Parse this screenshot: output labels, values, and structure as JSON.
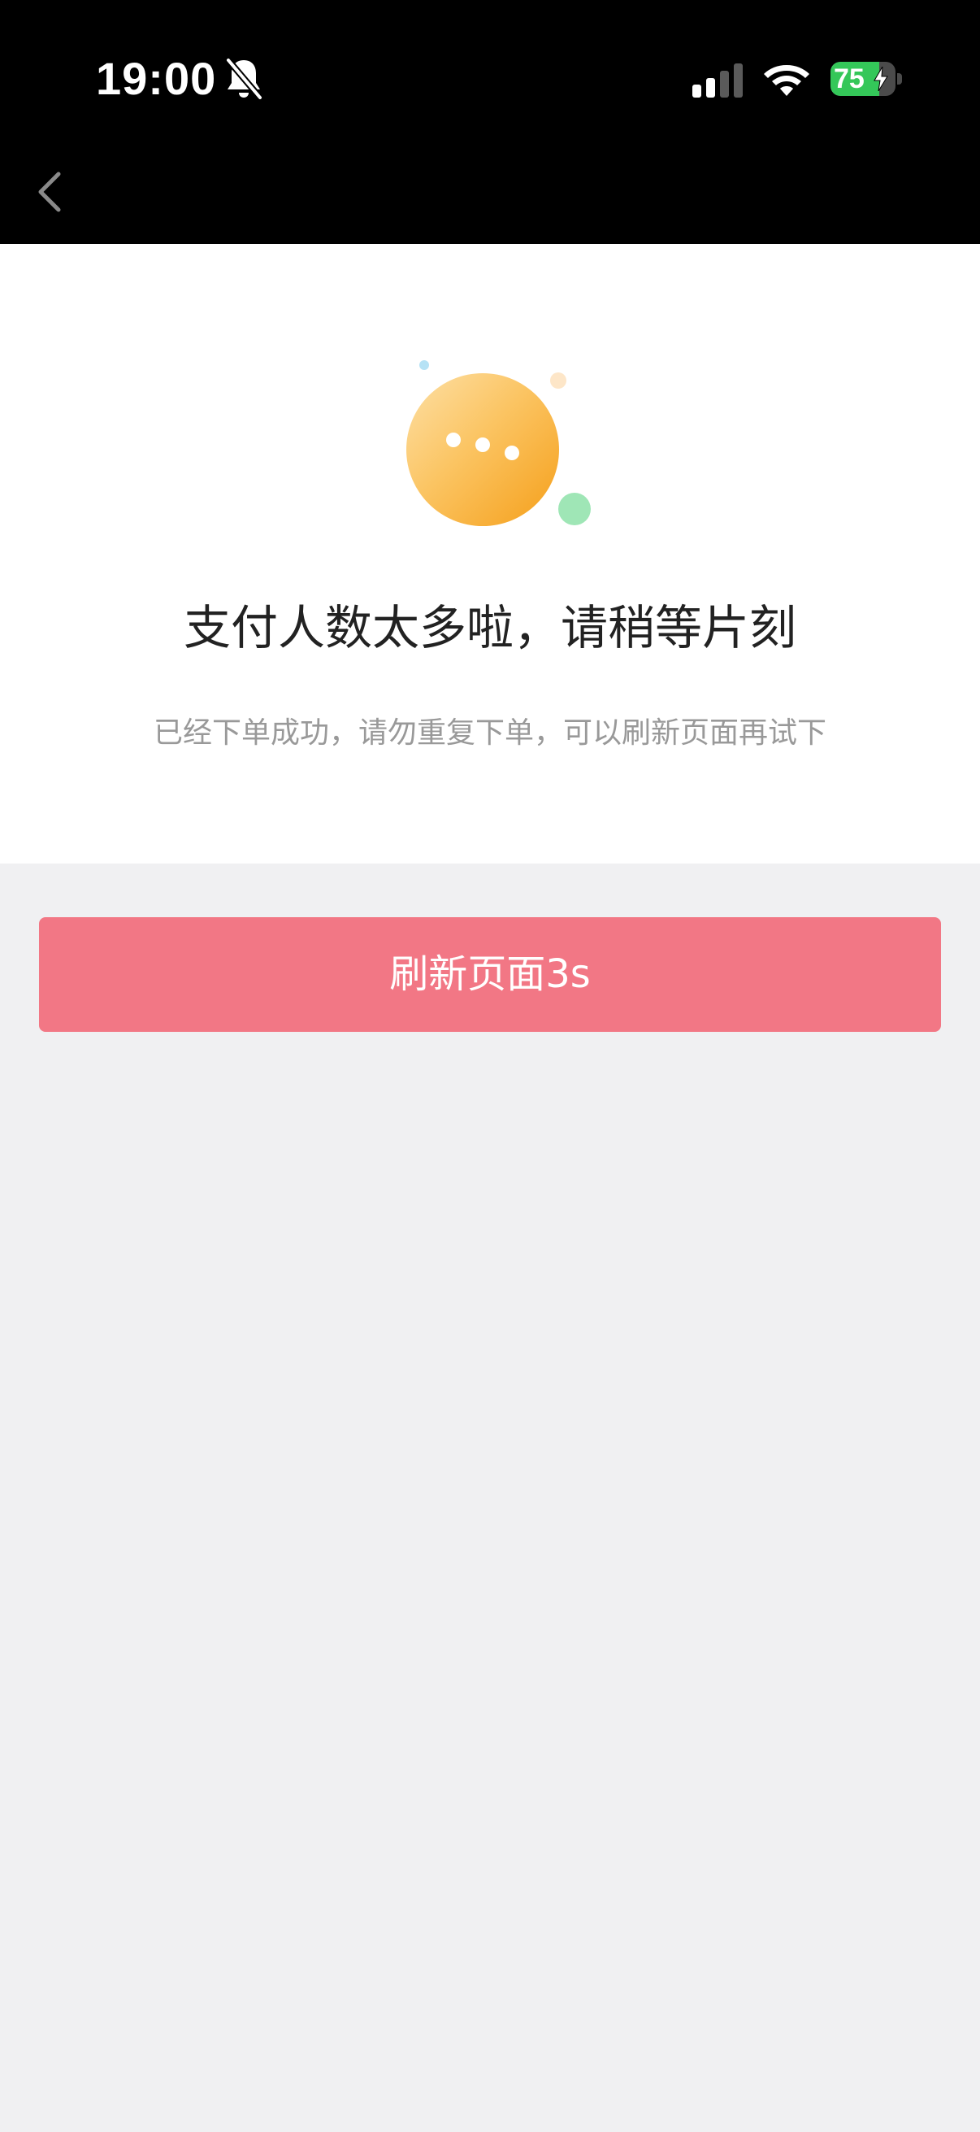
{
  "status_bar": {
    "time": "19:00",
    "battery_level": "75",
    "icons": [
      "bell-off-icon",
      "signal-icon",
      "wifi-icon",
      "battery-icon",
      "bolt-icon"
    ]
  },
  "nav": {
    "back_icon": "chevron-left-icon"
  },
  "main": {
    "illustration_icon": "chat-bubble-dots-icon",
    "headline": "支付人数太多啦，请稍等片刻",
    "subtext": "已经下单成功，请勿重复下单，可以刷新页面再试下"
  },
  "actions": {
    "refresh_label": "刷新页面3s"
  },
  "colors": {
    "top_bar": "#000000",
    "background": "#f0f0f2",
    "card": "#ffffff",
    "button": "#f27785",
    "battery_green": "#34c759",
    "illustration_orange": "#f7a827"
  }
}
